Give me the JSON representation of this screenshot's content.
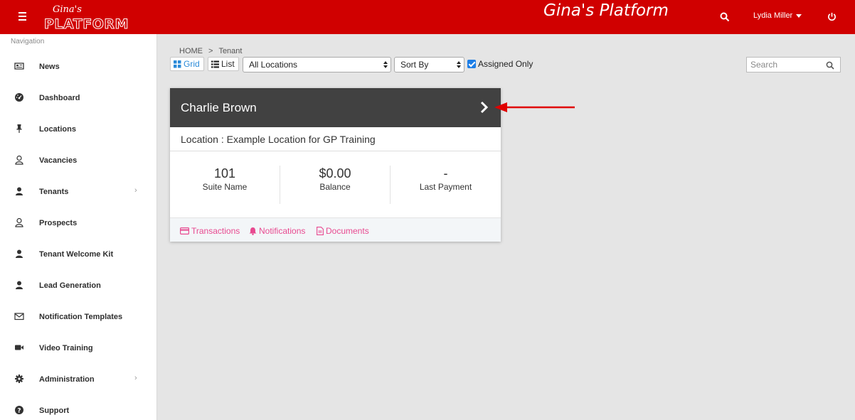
{
  "header": {
    "logo_script": "Gina's",
    "logo_main": "PLATFORM",
    "title": "Gina's Platform",
    "user_name": "Lydia Miller",
    "icons": [
      "hamburger-icon",
      "search-icon",
      "caret-down-icon",
      "power-icon"
    ]
  },
  "sidebar": {
    "caption": "Navigation",
    "items": [
      {
        "label": "News",
        "icon": "newspaper-icon"
      },
      {
        "label": "Dashboard",
        "icon": "gauge-icon"
      },
      {
        "label": "Locations",
        "icon": "pin-icon"
      },
      {
        "label": "Vacancies",
        "icon": "user-outline-icon"
      },
      {
        "label": "Tenants",
        "icon": "user-icon",
        "has_submenu": true
      },
      {
        "label": "Prospects",
        "icon": "user-outline-icon"
      },
      {
        "label": "Tenant Welcome Kit",
        "icon": "user-icon"
      },
      {
        "label": "Lead Generation",
        "icon": "user-icon"
      },
      {
        "label": "Notification Templates",
        "icon": "envelope-icon"
      },
      {
        "label": "Video Training",
        "icon": "video-camera-icon"
      },
      {
        "label": "Administration",
        "icon": "gear-icon",
        "has_submenu": true
      },
      {
        "label": "Support",
        "icon": "question-circle-icon"
      }
    ]
  },
  "breadcrumb": {
    "home": "HOME",
    "separator": ">",
    "current": "Tenant"
  },
  "toolbar": {
    "grid_label": "Grid",
    "list_label": "List",
    "location_select": "All Locations",
    "sort_select": "Sort By",
    "assigned_only_label": "Assigned Only",
    "assigned_only_checked": true,
    "search_placeholder": "Search"
  },
  "tenant_card": {
    "name": "Charlie Brown",
    "location": "Location : Example Location for GP Training",
    "stats": [
      {
        "value": "101",
        "label": "Suite Name"
      },
      {
        "value": "$0.00",
        "label": "Balance"
      },
      {
        "value": "-",
        "label": "Last Payment"
      }
    ],
    "links": {
      "transactions": "Transactions",
      "notifications": "Notifications",
      "documents": "Documents"
    }
  },
  "colors": {
    "brand_red": "#d00000",
    "card_header": "#414141",
    "link_pink": "#e84a90",
    "accent_blue": "#2a8ad8",
    "arrow_red": "#e00000"
  }
}
